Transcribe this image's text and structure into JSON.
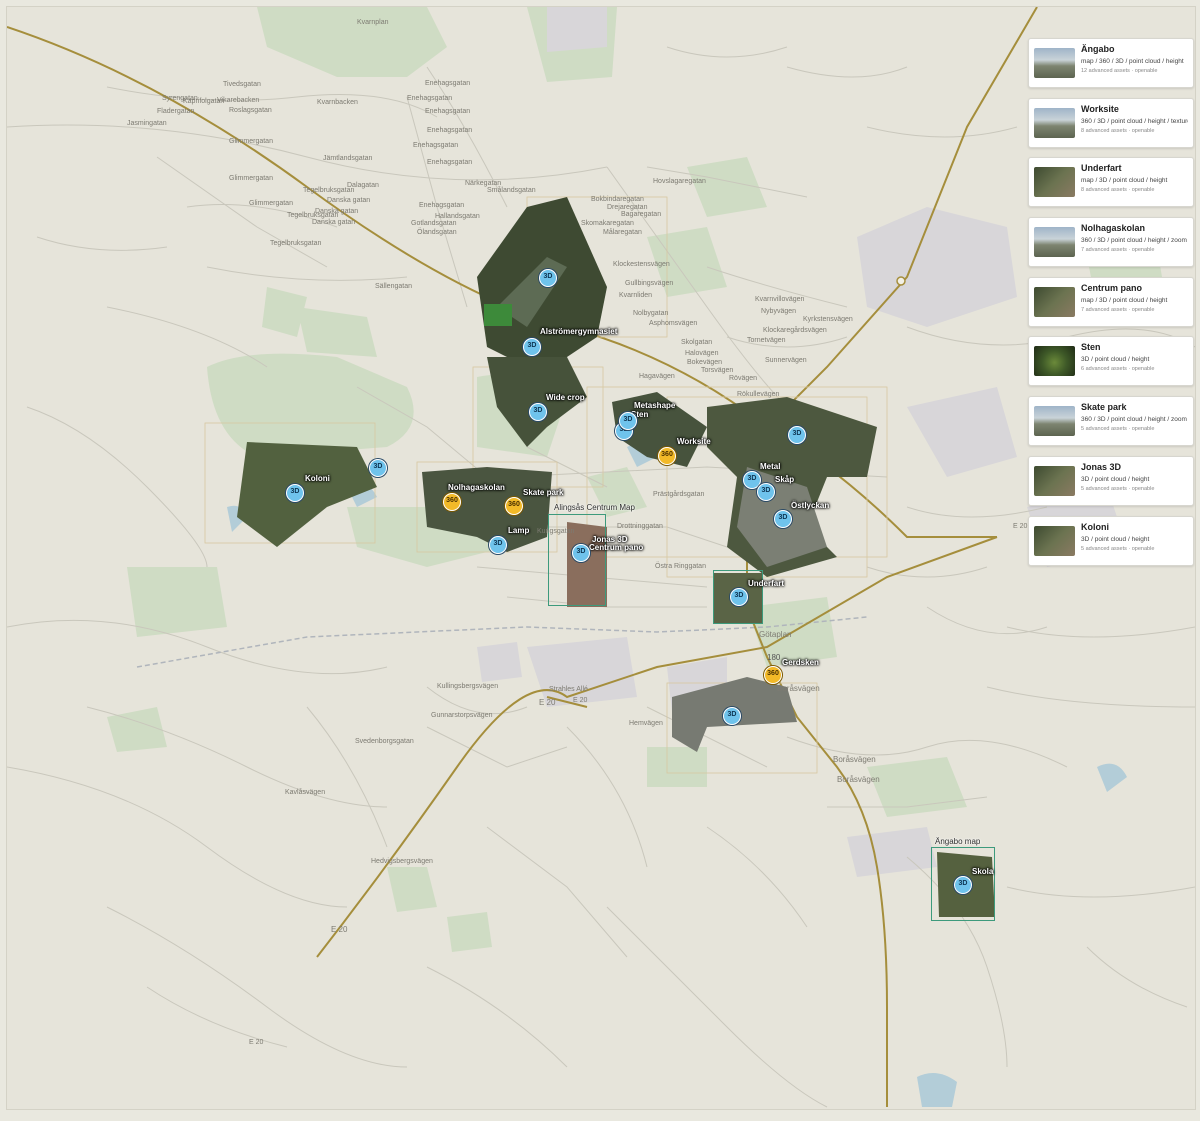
{
  "colors": {
    "land": "#e6e4da",
    "road": "#c9c7bc",
    "major_road": "#a58e3c",
    "green": "#cfdcc4",
    "aerial_dark": "#3e4a32",
    "marker_3d": "#6fc3ec",
    "marker_360": "#f2b928",
    "coverage": "#3d9a7c"
  },
  "assets": [
    {
      "name": "Ängabo",
      "types": "map / 360 / 3D / point cloud / height",
      "meta": "12 advanced assets · openable",
      "thumb": "pano-icon"
    },
    {
      "name": "Worksite",
      "types": "360 / 3D / point cloud / height / texture",
      "meta": "8 advanced assets · openable",
      "thumb": "pano-icon"
    },
    {
      "name": "Underfart",
      "types": "map / 3D / point cloud / height",
      "meta": "8 advanced assets · openable",
      "thumb": "aerial-icon"
    },
    {
      "name": "Nolhagaskolan",
      "types": "360 / 3D / point cloud / height / zoom",
      "meta": "7 advanced assets · openable",
      "thumb": "pano-icon"
    },
    {
      "name": "Centrum pano",
      "types": "map / 3D / point cloud / height",
      "meta": "7 advanced assets · openable",
      "thumb": "aerial-icon"
    },
    {
      "name": "Sten",
      "types": "3D / point cloud / height",
      "meta": "6 advanced assets · openable",
      "thumb": "model-icon"
    },
    {
      "name": "Skate park",
      "types": "360 / 3D / point cloud / height / zoom",
      "meta": "5 advanced assets · openable",
      "thumb": "pano-icon"
    },
    {
      "name": "Jonas 3D",
      "types": "3D / point cloud / height",
      "meta": "5 advanced assets · openable",
      "thumb": "aerial-icon"
    },
    {
      "name": "Koloni",
      "types": "3D / point cloud / height",
      "meta": "5 advanced assets · openable",
      "thumb": "aerial-icon"
    }
  ],
  "map_titles": {
    "centrum": "Alingsås Centrum Map",
    "angabo": "Ängabo map"
  },
  "poi_labels": {
    "alstromer": "Alströmergymnasiet",
    "wide_crop": "Wide crop",
    "metashape": "Metashape",
    "sten": "Sten",
    "worksite": "Worksite",
    "koloni": "Koloni",
    "nolhagaskolan": "Nolhagaskolan",
    "skate_park": "Skate park",
    "lamp": "Lamp",
    "jonas3d": "Jonas 3D",
    "centrum_pano": "Centrum pano",
    "metal": "Metal",
    "skap": "Skåp",
    "ostlyckan": "Östlyckan",
    "underfart": "Underfart",
    "gerdsken": "Gerdsken",
    "skola": "Skola",
    "road_180": "180"
  },
  "marker_labels": {
    "m3d": "3D",
    "m360": "360"
  },
  "streets": {
    "kvarnplan": "Kvarnplan",
    "tivedsgatan": "Tivedsgatan",
    "syrengatan": "Syrengatan",
    "kaprifolgatan": "Kaprifolgatan",
    "fladergatan": "Fladergatan",
    "vikarebacken": "Vikarebacken",
    "roslagsgatan": "Roslagsgatan",
    "kvarnbacken": "Kvarnbacken",
    "jasmingatan": "Jasmingatan",
    "glimmergatan1": "Glimmergatan",
    "glimmergatan2": "Glimmergatan",
    "glimmergatan3": "Glimmergatan",
    "jamtlandsgatan": "Jämtlandsgatan",
    "dalagatan": "Dalagatan",
    "tegelbruksgatan1": "Tegelbruksgatan",
    "tegelbruksgatan2": "Tegelbruksgatan",
    "tegelbruksgatan3": "Tegelbruksgatan",
    "danska1": "Danska gatan",
    "danska2": "Danska gatan",
    "danska3": "Danska gatan",
    "sallengatan": "Sällengatan",
    "enehagsgatan1": "Enehagsgatan",
    "enehagsgatan2": "Enehagsgatan",
    "enehagsgatan3": "Enehagsgatan",
    "enehagsgatan4": "Enehagsgatan",
    "enehagsgatan5": "Enehagsgatan",
    "enehagsgatan6": "Enehagsgatan",
    "enehagsgatan7": "Enehagsgatan",
    "narkegatan": "Närkegatan",
    "smalandsgatan": "Smålandsgatan",
    "hallandsgatan": "Hallandsgatan",
    "gotlandsgatan": "Gotlandsgatan",
    "olandsgatan": "Ölandsgatan",
    "hovslagaregatan": "Hovslagaregatan",
    "bokbindaregatan": "Bokbindaregatan",
    "drejaregatan": "Drejaregatan",
    "bagaregatan": "Bagaregatan",
    "skomakaregatan": "Skomakaregatan",
    "malaregatan": "Målaregatan",
    "klockestensvagen": "Klockestensvägen",
    "gullbingsvagen": "Gullbingsvägen",
    "kvarnliden": "Kvarnliden",
    "kvarnvillovagen": "Kvarnvillovägen",
    "nybyvagen": "Nybyvägen",
    "kyrkstensvagen": "Kyrkstensvägen",
    "klockaregardsvagen": "Klockaregårdsvägen",
    "asphomsvagen": "Asphomsvägen",
    "nolbygatan": "Nolbygatan",
    "tornetvagen": "Tornetvägen",
    "sunnervagen": "Sunnervägen",
    "hagavagen": "Hagavägen",
    "rovagen": "Rövägen",
    "rokullevagen": "Rökullevägen",
    "skolgatan": "Skolgatan",
    "halovagen": "Halovägen",
    "bokevagen": "Bokevägen",
    "torsvagen": "Torsvägen",
    "prastgardsgatan": "Prästgårdsgatan",
    "drottninggatan": "Drottninggatan",
    "ostra_ringgatan": "Östra Ringgatan",
    "kungsgatan": "Kungsgatan",
    "kullingsbergsvagen": "Kullingsbergsvägen",
    "gunnarstorpsvagen": "Gunnarstorpsvägen",
    "svedenborgsgatan": "Svedenborgsgatan",
    "kavlasvagen": "Kavlåsvägen",
    "hedvigsbergsvagen": "Hedvigsbergsvägen",
    "strahles_alle": "Strahles Allé",
    "hemvagen": "Hemvägen",
    "gotaplan": "Götaplan",
    "borasvagen1": "Boråsvägen",
    "borasvagen2": "Boråsvägen",
    "borasvagen3": "Boråsvägen",
    "e20_1": "E 20",
    "e20_2": "E 20",
    "e20_3": "E 20",
    "e20_4": "E 20",
    "e20_5": "E 20"
  }
}
